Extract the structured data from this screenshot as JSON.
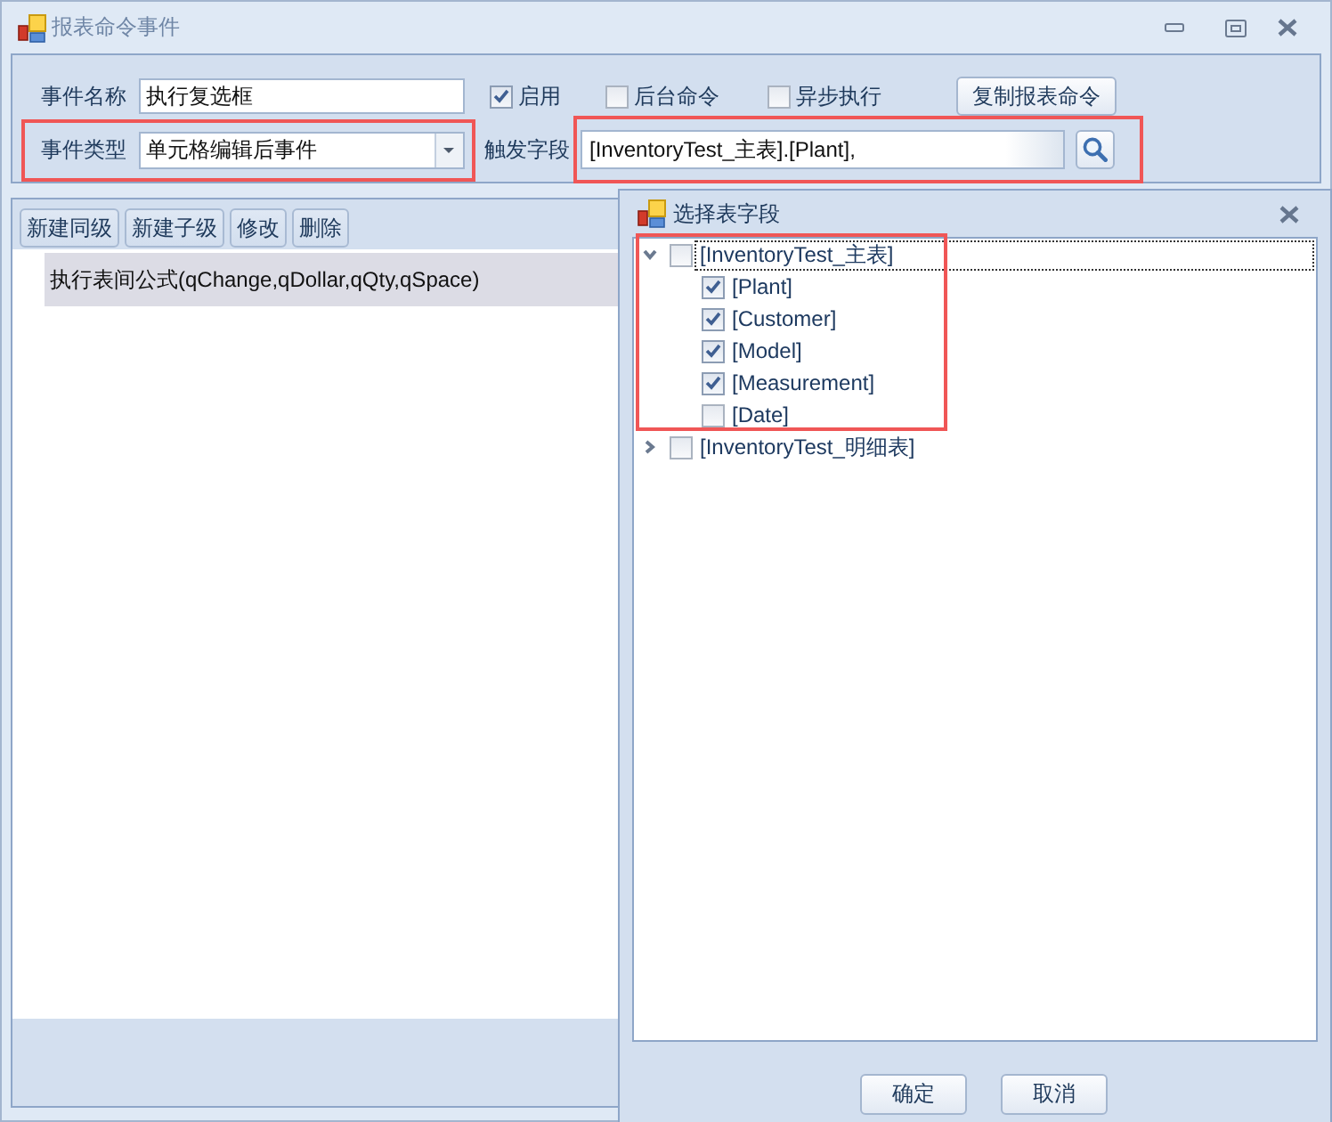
{
  "window": {
    "title": "报表命令事件"
  },
  "form": {
    "event_name": {
      "label": "事件名称",
      "value": "执行复选框"
    },
    "options": [
      {
        "label": "启用",
        "checked": true
      },
      {
        "label": "后台命令",
        "checked": false
      },
      {
        "label": "异步执行",
        "checked": false
      }
    ],
    "copy_button": "复制报表命令",
    "event_type": {
      "label": "事件类型",
      "value": "单元格编辑后事件",
      "highlighted": true
    },
    "trigger_field": {
      "label": "触发字段",
      "value": "[InventoryTest_主表].[Plant],",
      "highlighted": true
    }
  },
  "toolbar": [
    "新建同级",
    "新建子级",
    "修改",
    "删除"
  ],
  "commands": [
    {
      "text": "执行表间公式(qChange,qDollar,qQty,qSpace)",
      "selected": true
    }
  ],
  "dialog": {
    "title": "选择表字段",
    "tree": [
      {
        "label": "[InventoryTest_主表]",
        "checked": false,
        "expanded": true,
        "selected": true,
        "highlighted": true,
        "children": [
          {
            "label": "[Plant]",
            "checked": true,
            "selected": false
          },
          {
            "label": "[Customer]",
            "checked": true,
            "selected": false
          },
          {
            "label": "[Model]",
            "checked": true,
            "selected": false
          },
          {
            "label": "[Measurement]",
            "checked": true,
            "selected": false
          },
          {
            "label": "[Date]",
            "checked": false,
            "selected": false
          }
        ]
      },
      {
        "label": "[InventoryTest_明细表]",
        "checked": false,
        "expanded": false,
        "selected": false,
        "highlighted": false
      }
    ],
    "buttons": [
      "确定",
      "取消"
    ]
  }
}
